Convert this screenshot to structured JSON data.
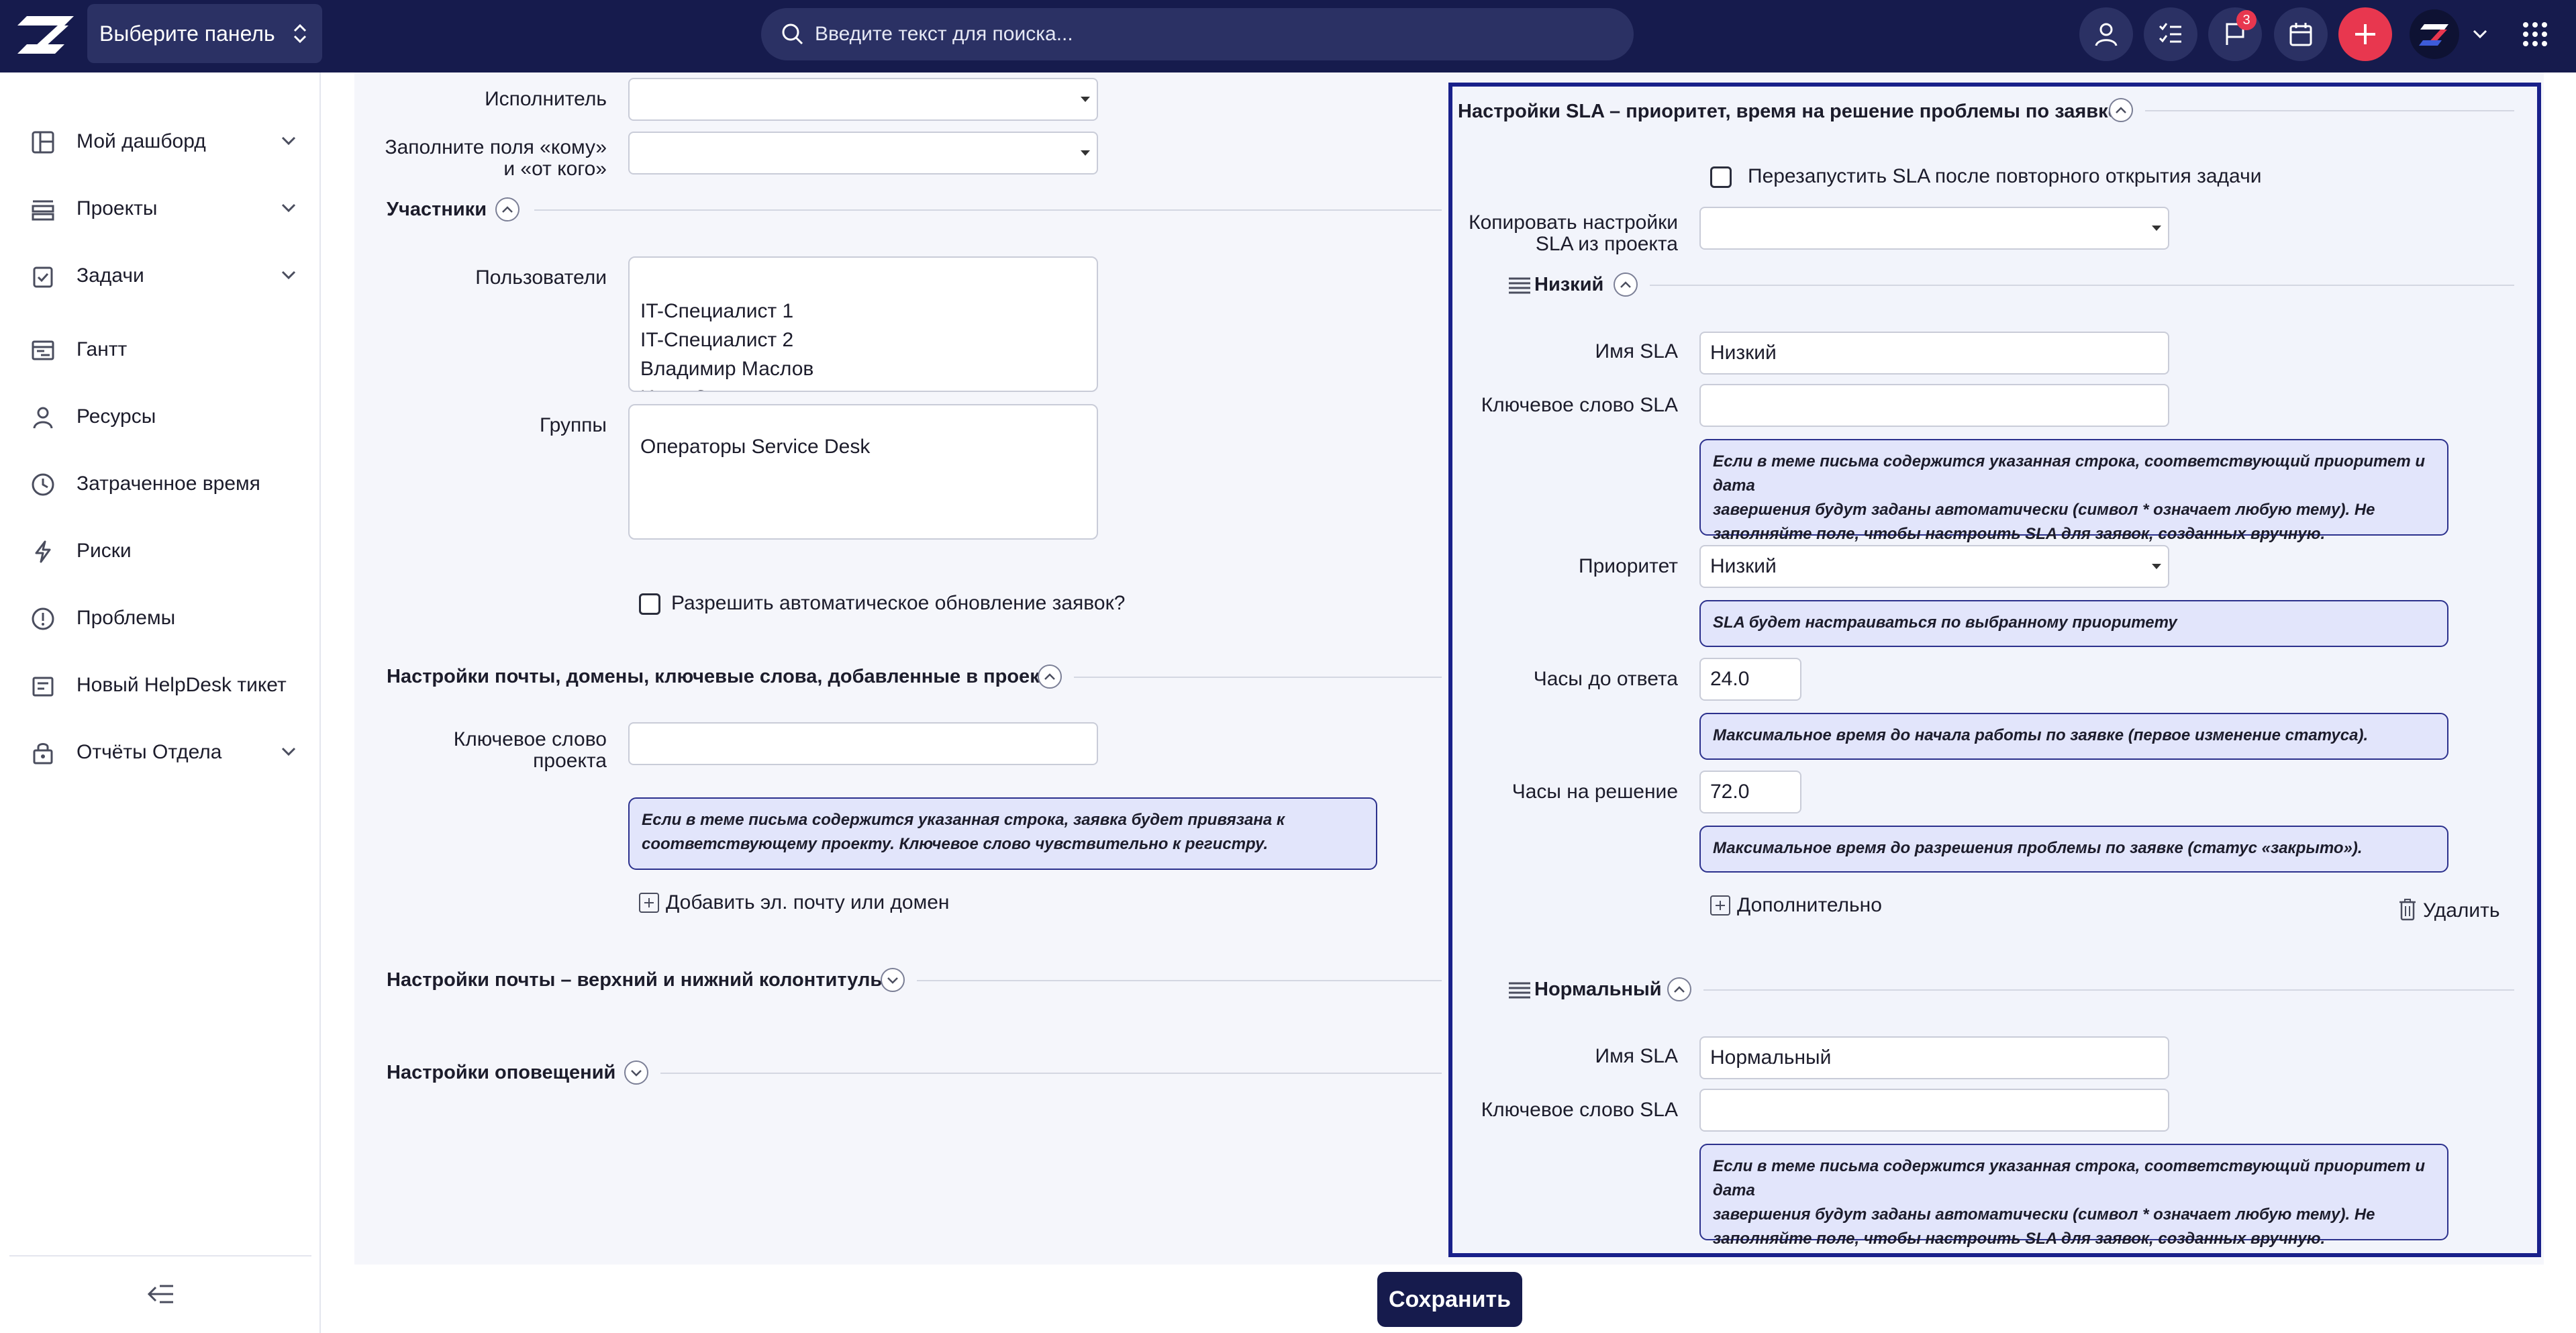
{
  "topbar": {
    "panel_select": "Выберите панель",
    "search_placeholder": "Введите текст для поиска...",
    "notifications_count": "3"
  },
  "sidebar": {
    "items": [
      {
        "label": "Мой дашборд",
        "icon": "dashboard-icon",
        "expandable": true
      },
      {
        "label": "Проекты",
        "icon": "projects-icon",
        "expandable": true
      },
      {
        "label": "Задачи",
        "icon": "tasks-icon",
        "expandable": true
      },
      {
        "label": "Гантт",
        "icon": "gantt-icon",
        "expandable": false
      },
      {
        "label": "Ресурсы",
        "icon": "user-icon",
        "expandable": false
      },
      {
        "label": "Затраченное время",
        "icon": "clock-icon",
        "expandable": false
      },
      {
        "label": "Риски",
        "icon": "bolt-icon",
        "expandable": false
      },
      {
        "label": "Проблемы",
        "icon": "alert-icon",
        "expandable": false
      },
      {
        "label": "Новый HelpDesk тикет",
        "icon": "ticket-icon",
        "expandable": false
      },
      {
        "label": "Отчёты Отдела",
        "icon": "reports-icon",
        "expandable": true
      }
    ]
  },
  "form": {
    "assignee_label": "Исполнитель",
    "assignee_value": "",
    "fill_fields_label_1": "Заполните поля «кому»",
    "fill_fields_label_2": "и «от кого»",
    "fill_fields_value": "",
    "participants_title": "Участники",
    "users_label": "Пользователи",
    "users": [
      "IT-Специалист 1",
      "IT-Специалист 2",
      "Владимир Маслов",
      "Иван Смирнов"
    ],
    "groups_label": "Группы",
    "groups": [
      "Операторы Service Desk"
    ],
    "auto_update_label": "Разрешить автоматическое обновление заявок?",
    "mail_section_title": "Настройки почты, домены, ключевые слова, добавленные в проект",
    "project_keyword_label_1": "Ключевое слово",
    "project_keyword_label_2": "проекта",
    "project_keyword_value": "",
    "project_keyword_hint_1": "Если в теме письма содержится указанная строка, заявка будет привязана к",
    "project_keyword_hint_2": "соответствующему проекту. Ключевое слово чувствительно к регистру.",
    "add_email_domain": "Добавить эл. почту или домен",
    "header_footer_title": "Настройки почты – верхний и нижний колонтитулы",
    "notifications_title": "Настройки оповещений"
  },
  "sla": {
    "title": "Настройки SLA – приоритет, время на решение проблемы по заявке",
    "restart_label": "Перезапустить SLA после повторного открытия задачи",
    "copy_label_1": "Копировать настройки",
    "copy_label_2": "SLA из проекта",
    "copy_value": "",
    "name_label": "Имя SLA",
    "keyword_label": "Ключевое слово SLA",
    "keyword_hint_1": "Если в теме письма содержится указанная строка, соответствующий приоритет и дата",
    "keyword_hint_2": "завершения будут заданы автоматически (символ * означает любую тему). Не",
    "keyword_hint_3": "заполняйте поле, чтобы настроить SLA для заявок, созданных вручную.",
    "priority_label": "Приоритет",
    "priority_hint": "SLA будет настраиваться по выбранному приоритету",
    "response_label": "Часы до ответа",
    "response_hint": "Максимальное время до начала работы по заявке (первое изменение статуса).",
    "resolve_label": "Часы на решение",
    "resolve_hint": "Максимальное время до разрешения проблемы по заявке (статус «закрыто»).",
    "additional": "Дополнительно",
    "delete": "Удалить",
    "blocks": [
      {
        "title": "Низкий",
        "name_value": "Низкий",
        "keyword_value": "",
        "priority_value": "Низкий",
        "response_value": "24.0",
        "resolve_value": "72.0"
      },
      {
        "title": "Нормальный",
        "name_value": "Нормальный",
        "keyword_value": ""
      }
    ]
  },
  "actions": {
    "save": "Сохранить"
  }
}
